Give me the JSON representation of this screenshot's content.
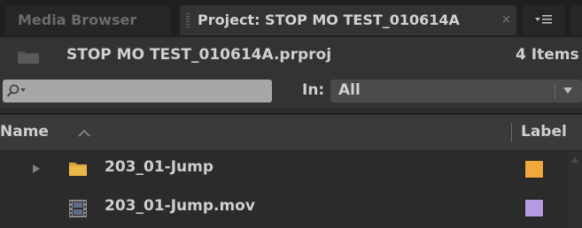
{
  "tabs": {
    "media_browser": "Media Browser",
    "project": "Project: STOP MO TEST_010614A",
    "close_glyph": "×",
    "menu_icon": "panel-menu-icon"
  },
  "project": {
    "name": "STOP MO TEST_010614A.prproj",
    "item_count": "4 Items"
  },
  "search": {
    "value": "",
    "in_label": "In:",
    "in_value": "All"
  },
  "columns": {
    "name": "Name",
    "label": "Label"
  },
  "items": [
    {
      "name": "203_01-Jump",
      "type": "bin",
      "icon": "folder-icon",
      "label_color": "#f3a83b"
    },
    {
      "name": "203_01-Jump.mov",
      "type": "clip",
      "icon": "film-icon",
      "label_color": "#b39ce0"
    }
  ]
}
